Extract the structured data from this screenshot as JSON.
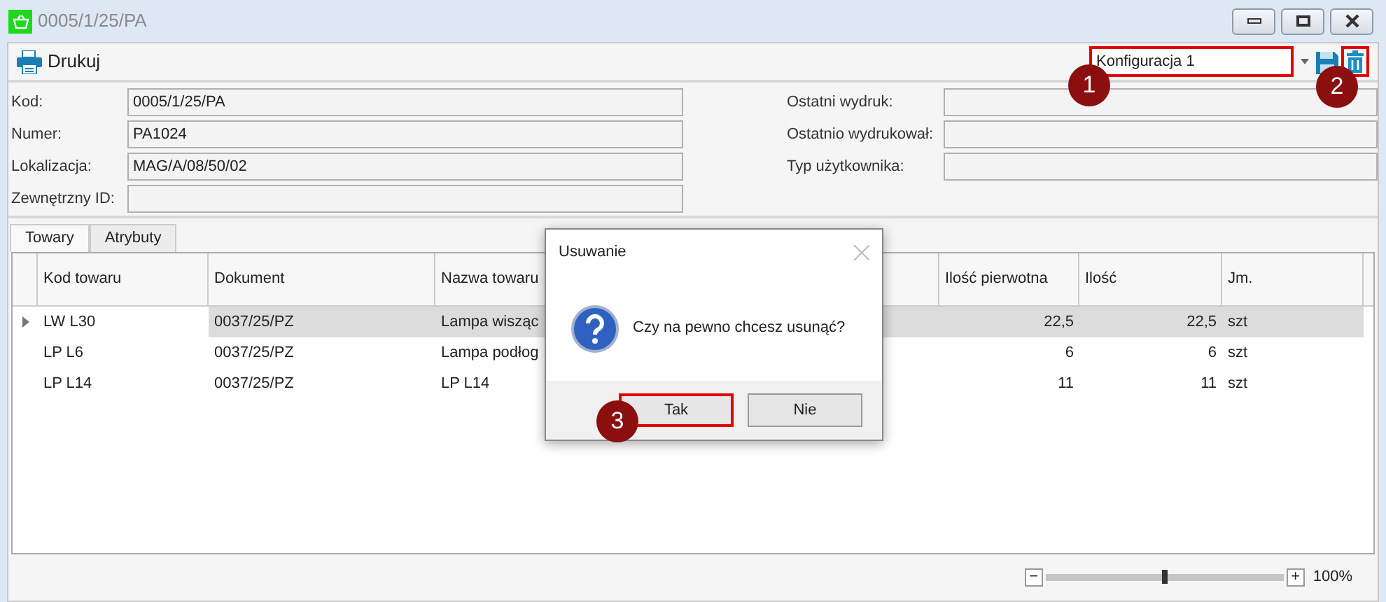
{
  "window": {
    "title": "0005/1/25/PA"
  },
  "toolbar": {
    "print_button": "Drukuj",
    "configuration": {
      "value": "Konfiguracja 1",
      "highlighted": true,
      "annotation": "1"
    },
    "delete_button": {
      "highlighted": true,
      "annotation": "2"
    }
  },
  "fields_left": [
    {
      "label": "Kod:",
      "value": "0005/1/25/PA"
    },
    {
      "label": "Numer:",
      "value": "PA1024"
    },
    {
      "label": "Lokalizacja:",
      "value": "MAG/A/08/50/02"
    },
    {
      "label": "Zewnętrzny ID:"
    }
  ],
  "fields_right": [
    {
      "label": "Ostatni wydruk:"
    },
    {
      "label": "Ostatnio wydrukował:"
    },
    {
      "label": "Typ użytkownika:"
    }
  ],
  "tabs": [
    {
      "label": "Towary",
      "selected": true
    },
    {
      "label": "Atrybuty",
      "selected": false
    }
  ],
  "table": {
    "columns": [
      {
        "label": "Kod towaru",
        "kind": "text"
      },
      {
        "label": "Dokument",
        "kind": "text"
      },
      {
        "label": "Nazwa towaru",
        "kind": "text"
      },
      {
        "label": "Ilość pierwotna",
        "kind": "number"
      },
      {
        "label": "Ilość",
        "kind": "number"
      },
      {
        "label": "Jm.",
        "kind": "text"
      }
    ],
    "rows": [
      {
        "selected": true,
        "cells": [
          "LW L30",
          "0037/25/PZ",
          "Lampa wisząc",
          "22,5",
          "22,5",
          "szt"
        ]
      },
      {
        "selected": false,
        "cells": [
          "LP L6",
          "0037/25/PZ",
          "Lampa podłog",
          "6",
          "6",
          "szt"
        ]
      },
      {
        "selected": false,
        "cells": [
          "LP L14",
          "0037/25/PZ",
          "LP L14",
          "11",
          "11",
          "szt"
        ]
      }
    ]
  },
  "dialog": {
    "title": "Usuwanie",
    "message": "Czy na pewno chcesz usunąć?",
    "buttons": [
      {
        "label": "Tak",
        "highlighted": true,
        "annotation": "3"
      },
      {
        "label": "Nie",
        "highlighted": false
      }
    ]
  },
  "zoom": {
    "minus": "−",
    "plus": "+",
    "level": 0.5,
    "reading": "100%"
  }
}
